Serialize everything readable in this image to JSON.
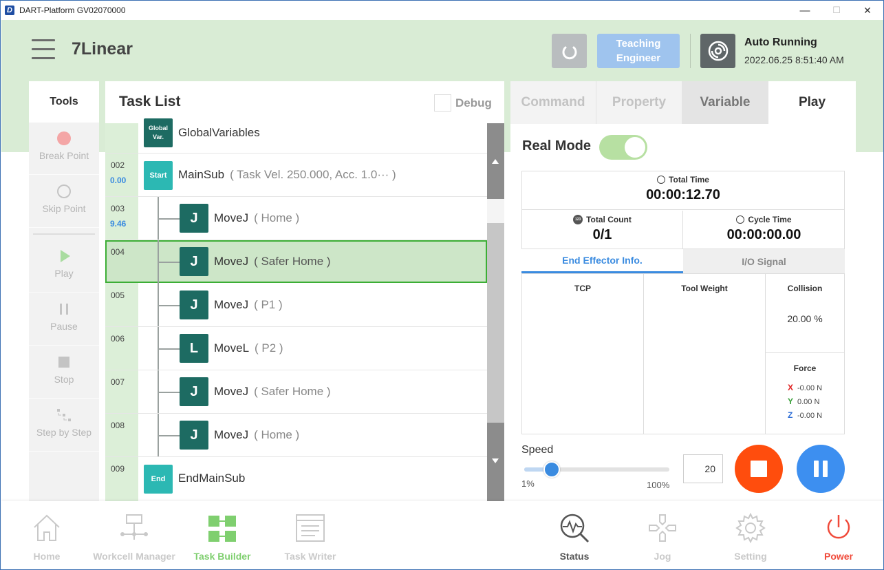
{
  "window": {
    "title": "DART-Platform GV02070000",
    "logo": "D",
    "controls": {
      "minimize": "—",
      "maximize": "☐",
      "close": "✕"
    }
  },
  "header": {
    "project_title": "7Linear",
    "teaching_line1": "Teaching",
    "teaching_line2": "Engineer",
    "robot_state": "Auto Running",
    "robot_time": "2022.06.25 8:51:40 AM"
  },
  "tools": {
    "title": "Tools",
    "items": [
      {
        "label": "Break Point",
        "icon": "record-dot-icon"
      },
      {
        "label": "Skip Point",
        "icon": "circle-outline-icon"
      },
      {
        "label": "Play",
        "icon": "play-icon"
      },
      {
        "label": "Pause",
        "icon": "pause-icon"
      },
      {
        "label": "Stop",
        "icon": "stop-icon"
      },
      {
        "label": "Step by Step",
        "icon": "step-icon"
      }
    ]
  },
  "task_list": {
    "title": "Task List",
    "debug_label": "Debug",
    "rows": [
      {
        "num": "",
        "value": "",
        "block": "Global Var.",
        "command": "GlobalVariables",
        "args": ""
      },
      {
        "num": "002",
        "value": "0.00",
        "block": "Start",
        "command": "MainSub",
        "args": "( Task Vel. 250.000, Acc. 1.0··· )"
      },
      {
        "num": "003",
        "value": "9.46",
        "block": "J",
        "command": "MoveJ",
        "args": "( Home )"
      },
      {
        "num": "004",
        "value": "",
        "block": "J",
        "command": "MoveJ",
        "args": "( Safer Home )"
      },
      {
        "num": "005",
        "value": "",
        "block": "J",
        "command": "MoveJ",
        "args": "( P1 )"
      },
      {
        "num": "006",
        "value": "",
        "block": "L",
        "command": "MoveL",
        "args": "( P2 )"
      },
      {
        "num": "007",
        "value": "",
        "block": "J",
        "command": "MoveJ",
        "args": "( Safer Home )"
      },
      {
        "num": "008",
        "value": "",
        "block": "J",
        "command": "MoveJ",
        "args": "( Home )"
      },
      {
        "num": "009",
        "value": "",
        "block": "End",
        "command": "EndMainSub",
        "args": ""
      }
    ]
  },
  "right_panel": {
    "tabs": [
      "Command",
      "Property",
      "Variable",
      "Play"
    ],
    "active_tab": "Play",
    "real_mode_label": "Real Mode",
    "real_mode_on": true,
    "total_time_label": "Total Time",
    "total_time": "00:00:12.70",
    "total_count_label": "Total Count",
    "total_count": "0/1",
    "count_icon_text": "123",
    "cycle_time_label": "Cycle Time",
    "cycle_time": "00:00:00.00",
    "subtabs": [
      "End Effector Info.",
      "I/O Signal"
    ],
    "tcp_label": "TCP",
    "tool_weight_label": "Tool Weight",
    "collision_label": "Collision",
    "collision_value": "20.00 %",
    "force_label": "Force",
    "force_x": "-0.00 N",
    "force_y": "0.00 N",
    "force_z": "-0.00 N",
    "axis_x": "X",
    "axis_y": "Y",
    "axis_z": "Z",
    "speed_label": "Speed",
    "speed_min": "1%",
    "speed_max": "100%",
    "speed_value": "20",
    "speed_percent": 20
  },
  "bottom_nav": [
    {
      "label": "Home",
      "icon": "home-icon"
    },
    {
      "label": "Workcell Manager",
      "icon": "workcell-icon"
    },
    {
      "label": "Task Builder",
      "icon": "task-builder-icon"
    },
    {
      "label": "Task Writer",
      "icon": "task-writer-icon"
    },
    {
      "label": "Status",
      "icon": "status-icon"
    },
    {
      "label": "Jog",
      "icon": "jog-icon"
    },
    {
      "label": "Setting",
      "icon": "gear-icon"
    },
    {
      "label": "Power",
      "icon": "power-icon"
    }
  ],
  "colors": {
    "header_bg": "#d9ecd5",
    "accent_blue": "#3a8be0",
    "stop_red": "#ff4d0d",
    "task_builder_green": "#7fcf6f",
    "power_red": "#f04a3a",
    "block_dark": "#1d6b62",
    "block_teal": "#2cb8b3"
  }
}
